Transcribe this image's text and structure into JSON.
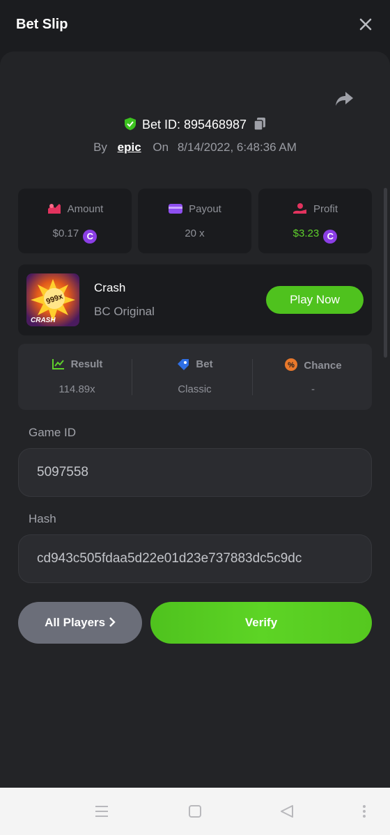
{
  "header": {
    "title": "Bet Slip"
  },
  "bet": {
    "id_label": "Bet ID: 895468987",
    "by_label": "By",
    "user": "epic",
    "on_label": "On",
    "date": "8/14/2022, 6:48:36 AM"
  },
  "stats": {
    "amount_label": "Amount",
    "amount_value": "$0.17",
    "payout_label": "Payout",
    "payout_value": "20 x",
    "profit_label": "Profit",
    "profit_value": "$3.23",
    "coin_glyph": "C"
  },
  "game": {
    "name": "Crash",
    "provider": "BC Original",
    "play_label": "Play Now",
    "thumb_badge": "999x",
    "thumb_text": "CRASH"
  },
  "info": {
    "result_label": "Result",
    "result_value": "114.89x",
    "bet_label": "Bet",
    "bet_value": "Classic",
    "chance_label": "Chance",
    "chance_value": "-"
  },
  "fields": {
    "game_id_label": "Game ID",
    "game_id_value": "5097558",
    "hash_label": "Hash",
    "hash_value": "cd943c505fdaa5d22e01d23e737883dc5c9dc"
  },
  "buttons": {
    "all_players": "All Players",
    "verify": "Verify"
  },
  "colors": {
    "accent_green": "#4fc21e",
    "coin_purple": "#8b3ee5",
    "background": "#1b1c1f"
  },
  "icons": [
    "close-icon",
    "share-icon",
    "shield-check-icon",
    "copy-icon",
    "amount-icon",
    "payout-card-icon",
    "profit-icon",
    "coin-icon",
    "result-chart-icon",
    "bet-tag-icon",
    "percent-icon",
    "chevron-right-icon",
    "menu-icon",
    "home-square-icon",
    "back-triangle-icon",
    "more-dots-icon"
  ]
}
